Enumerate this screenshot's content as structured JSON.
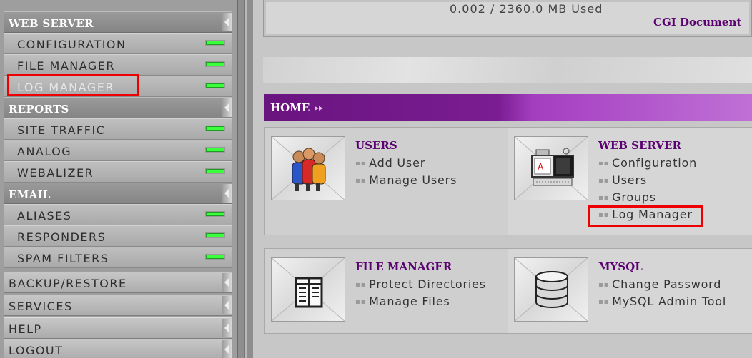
{
  "sidebar": {
    "web_server": {
      "header": "WEB SERVER",
      "items": [
        {
          "label": "CONFIGURATION"
        },
        {
          "label": "FILE MANAGER"
        },
        {
          "label": "LOG MANAGER"
        }
      ]
    },
    "reports": {
      "header": "REPORTS",
      "items": [
        {
          "label": "SITE TRAFFIC"
        },
        {
          "label": "ANALOG"
        },
        {
          "label": "WEBALIZER"
        }
      ]
    },
    "email": {
      "header": "EMAIL",
      "items": [
        {
          "label": "ALIASES"
        },
        {
          "label": "RESPONDERS"
        },
        {
          "label": "SPAM FILTERS"
        }
      ]
    },
    "bottom": [
      {
        "label": "BACKUP/RESTORE"
      },
      {
        "label": "SERVICES"
      },
      {
        "label": "HELP"
      },
      {
        "label": "LOGOUT"
      }
    ]
  },
  "usage": {
    "text": "0.002 / 2360.0 MB Used",
    "cgi_link": "CGI Document"
  },
  "breadcrumb": {
    "home": "HOME",
    "arrows": "▸▸"
  },
  "sections": {
    "users": {
      "title": "USERS",
      "links": [
        "Add User",
        "Manage Users"
      ]
    },
    "web_server": {
      "title": "WEB SERVER",
      "links": [
        "Configuration",
        "Users",
        "Groups",
        "Log Manager"
      ]
    },
    "file_manager": {
      "title": "FILE MANAGER",
      "links": [
        "Protect Directories",
        "Manage Files"
      ]
    },
    "mysql": {
      "title": "MYSQL",
      "links": [
        "Change Password",
        "MySQL Admin Tool"
      ]
    }
  },
  "colors": {
    "accent_purple": "#5a0070",
    "status_led": "#39ff3c",
    "highlight_box": "#ee0000"
  }
}
